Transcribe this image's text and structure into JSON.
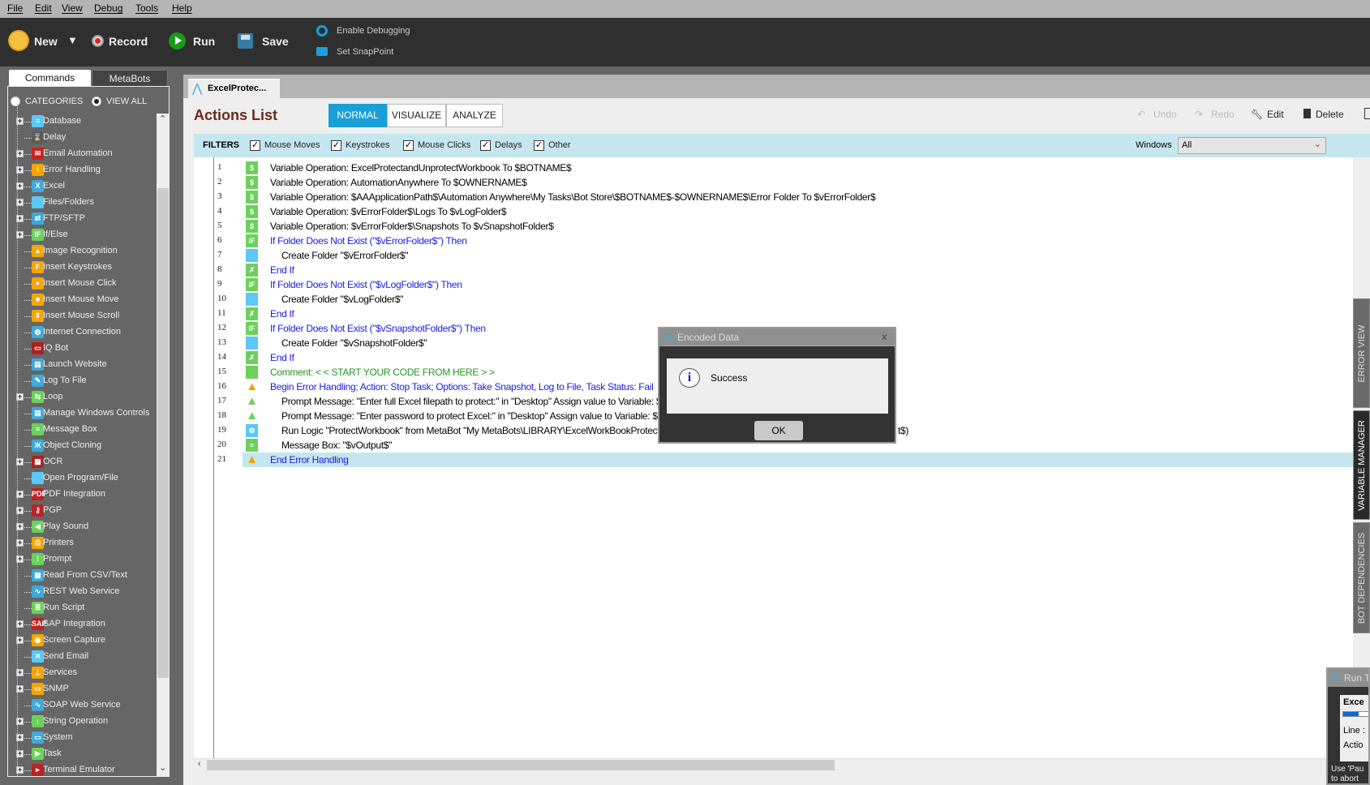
{
  "menu": [
    "File",
    "Edit",
    "View",
    "Debug",
    "Tools",
    "Help"
  ],
  "toolbar": {
    "new": "New",
    "record": "Record",
    "run": "Run",
    "save": "Save",
    "enable_debugging": "Enable Debugging",
    "set_snappoint": "Set SnapPoint"
  },
  "left_panel": {
    "tabs": [
      "Commands",
      "MetaBots"
    ],
    "radio_categories": "CATEGORIES",
    "radio_view_all": "VIEW ALL",
    "items": [
      {
        "label": "Database",
        "exp": true,
        "icon": "database-icon",
        "color": "#5bc8f5",
        "g": "≡"
      },
      {
        "label": "Delay",
        "exp": false,
        "icon": "hourglass-icon",
        "color": "#5c5c5c",
        "g": "⌛"
      },
      {
        "label": "Email Automation",
        "exp": true,
        "icon": "email-icon",
        "color": "#c22",
        "g": "✉"
      },
      {
        "label": "Error Handling",
        "exp": true,
        "icon": "warning-icon",
        "color": "#f5a500",
        "g": "!"
      },
      {
        "label": "Excel",
        "exp": true,
        "icon": "excel-icon",
        "color": "#3fa9d8",
        "g": "X"
      },
      {
        "label": "Files/Folders",
        "exp": true,
        "icon": "folder-icon",
        "color": "#5bc8f5",
        "g": ""
      },
      {
        "label": "FTP/SFTP",
        "exp": true,
        "icon": "ftp-icon",
        "color": "#3fa9d8",
        "g": "⇄"
      },
      {
        "label": "If/Else",
        "exp": true,
        "icon": "if-icon",
        "color": "#6cd05c",
        "g": "IF"
      },
      {
        "label": "Image Recognition",
        "exp": false,
        "icon": "image-icon",
        "color": "#f5a500",
        "g": "▲"
      },
      {
        "label": "Insert Keystrokes",
        "exp": false,
        "icon": "keystroke-icon",
        "color": "#f5a500",
        "g": "F"
      },
      {
        "label": "Insert Mouse Click",
        "exp": false,
        "icon": "mouse-click-icon",
        "color": "#f5a500",
        "g": "●"
      },
      {
        "label": "Insert Mouse Move",
        "exp": false,
        "icon": "mouse-move-icon",
        "color": "#f5a500",
        "g": "■"
      },
      {
        "label": "Insert Mouse Scroll",
        "exp": false,
        "icon": "mouse-scroll-icon",
        "color": "#f5a500",
        "g": "⇕"
      },
      {
        "label": "Internet Connection",
        "exp": false,
        "icon": "globe-icon",
        "color": "#3fa9d8",
        "g": "◍"
      },
      {
        "label": "IQ Bot",
        "exp": false,
        "icon": "iq-bot-icon",
        "color": "#a22",
        "g": "▭"
      },
      {
        "label": "Launch Website",
        "exp": false,
        "icon": "website-icon",
        "color": "#3fa9d8",
        "g": "▤"
      },
      {
        "label": "Log To File",
        "exp": false,
        "icon": "log-file-icon",
        "color": "#3fa9d8",
        "g": "✎"
      },
      {
        "label": "Loop",
        "exp": true,
        "icon": "loop-icon",
        "color": "#6cd05c",
        "g": "⇆"
      },
      {
        "label": "Manage Windows Controls",
        "exp": false,
        "icon": "windows-controls-icon",
        "color": "#3fa9d8",
        "g": "▤"
      },
      {
        "label": "Message Box",
        "exp": false,
        "icon": "message-box-icon",
        "color": "#6cd05c",
        "g": "≡"
      },
      {
        "label": "Object Cloning",
        "exp": false,
        "icon": "object-cloning-icon",
        "color": "#3fa9d8",
        "g": "Ж"
      },
      {
        "label": "OCR",
        "exp": true,
        "icon": "ocr-icon",
        "color": "#a22",
        "g": "▦"
      },
      {
        "label": "Open Program/File",
        "exp": false,
        "icon": "open-folder-icon",
        "color": "#5bc8f5",
        "g": ""
      },
      {
        "label": "PDF Integration",
        "exp": true,
        "icon": "pdf-icon",
        "color": "#b22",
        "g": "PDF"
      },
      {
        "label": "PGP",
        "exp": true,
        "icon": "key-icon",
        "color": "#b22",
        "g": "⚷"
      },
      {
        "label": "Play Sound",
        "exp": true,
        "icon": "speaker-icon",
        "color": "#6cd05c",
        "g": "◀"
      },
      {
        "label": "Printers",
        "exp": true,
        "icon": "printer-icon",
        "color": "#f5a500",
        "g": "⎙"
      },
      {
        "label": "Prompt",
        "exp": true,
        "icon": "prompt-icon",
        "color": "#6cd05c",
        "g": "!"
      },
      {
        "label": "Read From CSV/Text",
        "exp": false,
        "icon": "csv-icon",
        "color": "#3fa9d8",
        "g": "▦"
      },
      {
        "label": "REST Web Service",
        "exp": false,
        "icon": "rest-icon",
        "color": "#3fa9d8",
        "g": "∿"
      },
      {
        "label": "Run Script",
        "exp": false,
        "icon": "script-icon",
        "color": "#6cd05c",
        "g": "≣"
      },
      {
        "label": "SAP Integration",
        "exp": true,
        "icon": "sap-icon",
        "color": "#b22",
        "g": "SAP"
      },
      {
        "label": "Screen Capture",
        "exp": true,
        "icon": "camera-icon",
        "color": "#f5a500",
        "g": "◉"
      },
      {
        "label": "Send Email",
        "exp": false,
        "icon": "send-email-icon",
        "color": "#5bc8f5",
        "g": "✕"
      },
      {
        "label": "Services",
        "exp": true,
        "icon": "services-icon",
        "color": "#f5a500",
        "g": "⊥"
      },
      {
        "label": "SNMP",
        "exp": true,
        "icon": "snmp-icon",
        "color": "#f5a500",
        "g": "▭"
      },
      {
        "label": "SOAP Web Service",
        "exp": false,
        "icon": "soap-icon",
        "color": "#3fa9d8",
        "g": "∿"
      },
      {
        "label": "String Operation",
        "exp": true,
        "icon": "string-operation-icon",
        "color": "#6cd05c",
        "g": "↓"
      },
      {
        "label": "System",
        "exp": true,
        "icon": "system-icon",
        "color": "#3fa9d8",
        "g": "▭"
      },
      {
        "label": "Task",
        "exp": true,
        "icon": "task-icon",
        "color": "#6cd05c",
        "g": "▶"
      },
      {
        "label": "Terminal Emulator",
        "exp": true,
        "icon": "terminal-icon",
        "color": "#b22",
        "g": "▸"
      }
    ]
  },
  "document_tab": "ExcelProtec...",
  "actions": {
    "title": "Actions List",
    "modes": [
      "NORMAL",
      "VISUALIZE",
      "ANALYZE"
    ],
    "active_mode": "NORMAL",
    "undo": "Undo",
    "redo": "Redo",
    "edit": "Edit",
    "delete": "Delete"
  },
  "filters": {
    "label": "FILTERS",
    "items": [
      {
        "label": "Mouse Moves",
        "checked": true
      },
      {
        "label": "Keystrokes",
        "checked": true
      },
      {
        "label": "Mouse Clicks",
        "checked": true
      },
      {
        "label": "Delays",
        "checked": true
      },
      {
        "label": "Other",
        "checked": true
      }
    ],
    "windows_label": "Windows",
    "windows_value": "All"
  },
  "code": [
    {
      "n": "1",
      "icon": "variable-icon",
      "c": "#6cd05c",
      "g": "$",
      "indent": 0,
      "style": "",
      "text": "Variable Operation: ExcelProtectandUnprotectWorkbook To $BOTNAME$"
    },
    {
      "n": "2",
      "icon": "variable-icon",
      "c": "#6cd05c",
      "g": "$",
      "indent": 0,
      "style": "",
      "text": "Variable Operation: AutomationAnywhere To $OWNERNAME$"
    },
    {
      "n": "3",
      "icon": "variable-icon",
      "c": "#6cd05c",
      "g": "$",
      "indent": 0,
      "style": "",
      "text": "Variable Operation: $AAApplicationPath$\\Automation Anywhere\\My Tasks\\Bot Store\\$BOTNAME$-$OWNERNAME$\\Error Folder To $vErrorFolder$"
    },
    {
      "n": "4",
      "icon": "variable-icon",
      "c": "#6cd05c",
      "g": "$",
      "indent": 0,
      "style": "",
      "text": "Variable Operation: $vErrorFolder$\\Logs To $vLogFolder$"
    },
    {
      "n": "5",
      "icon": "variable-icon",
      "c": "#6cd05c",
      "g": "$",
      "indent": 0,
      "style": "",
      "text": "Variable Operation: $vErrorFolder$\\Snapshots To $vSnapshotFolder$"
    },
    {
      "n": "6",
      "icon": "if-icon",
      "c": "#6cd05c",
      "g": "IF",
      "indent": 0,
      "style": "blue",
      "text": "If Folder Does Not Exist (\"$vErrorFolder$\")  Then"
    },
    {
      "n": "7",
      "icon": "folder-icon",
      "c": "#5bc8f5",
      "g": "",
      "indent": 1,
      "style": "",
      "text": "Create Folder \"$vErrorFolder$\""
    },
    {
      "n": "8",
      "icon": "end-if-icon",
      "c": "#6cd05c",
      "g": "✗",
      "indent": 0,
      "style": "blue",
      "text": "End If"
    },
    {
      "n": "9",
      "icon": "if-icon",
      "c": "#6cd05c",
      "g": "IF",
      "indent": 0,
      "style": "blue",
      "text": "If Folder Does Not Exist (\"$vLogFolder$\")  Then"
    },
    {
      "n": "10",
      "icon": "folder-icon",
      "c": "#5bc8f5",
      "g": "",
      "indent": 1,
      "style": "",
      "text": "Create Folder \"$vLogFolder$\""
    },
    {
      "n": "11",
      "icon": "end-if-icon",
      "c": "#6cd05c",
      "g": "✗",
      "indent": 0,
      "style": "blue",
      "text": "End If"
    },
    {
      "n": "12",
      "icon": "if-icon",
      "c": "#6cd05c",
      "g": "IF",
      "indent": 0,
      "style": "blue",
      "text": "If Folder Does Not Exist (\"$vSnapshotFolder$\")  Then"
    },
    {
      "n": "13",
      "icon": "folder-icon",
      "c": "#5bc8f5",
      "g": "",
      "indent": 1,
      "style": "",
      "text": "Create Folder \"$vSnapshotFolder$\""
    },
    {
      "n": "14",
      "icon": "end-if-icon",
      "c": "#6cd05c",
      "g": "✗",
      "indent": 0,
      "style": "blue",
      "text": "End If"
    },
    {
      "n": "15",
      "icon": "comment-icon",
      "c": "#6cd05c",
      "g": "",
      "indent": 0,
      "style": "green",
      "text": "Comment: < < START YOUR CODE FROM HERE > >"
    },
    {
      "n": "16",
      "icon": "warning-icon",
      "c": "#f5a500",
      "g": "!",
      "indent": 0,
      "style": "blue",
      "text": "Begin Error Handling; Action: Stop Task; Options: Take Snapshot, Log to File,  Task Status: Fail"
    },
    {
      "n": "17",
      "icon": "prompt-icon",
      "c": "#6cd05c",
      "g": "!",
      "indent": 1,
      "style": "",
      "text": "Prompt Message: \"Enter full Excel filepath to protect:\" in \"Desktop\" Assign value to Variable: $vInp"
    },
    {
      "n": "18",
      "icon": "prompt-icon",
      "c": "#6cd05c",
      "g": "!",
      "indent": 1,
      "style": "",
      "text": "Prompt Message: \"Enter password to protect Excel:\" in \"Desktop\" Assign value to Variable: $vPW"
    },
    {
      "n": "19",
      "icon": "metabot-icon",
      "c": "#5bc8f5",
      "g": "⚙",
      "indent": 1,
      "style": "",
      "text": "Run Logic \"ProtectWorkbook\" from MetaBot \"My MetaBots\\LIBRARY\\ExcelWorkBookProtectOrU",
      "tail": "t$)"
    },
    {
      "n": "20",
      "icon": "message-box-icon",
      "c": "#6cd05c",
      "g": "≡",
      "indent": 1,
      "style": "",
      "text": "Message Box: \"$vOutput$\""
    },
    {
      "n": "21",
      "icon": "warning-icon",
      "c": "#f5a500",
      "g": "!",
      "indent": 0,
      "style": "blue",
      "text": "End Error Handling",
      "selected": true
    }
  ],
  "side_tabs": [
    "ERROR VIEW",
    "VARIABLE MANAGER",
    "BOT DEPENDENCIES"
  ],
  "dialog": {
    "title": "Encoded Data",
    "message": "Success",
    "ok": "OK",
    "close": "x"
  },
  "run_dialog": {
    "title": "Run T",
    "line1": "Exce",
    "line2": "Line :",
    "line3": "Actio",
    "footer1": "Use 'Pau",
    "footer2": "to abort",
    "progress": 0.5
  }
}
